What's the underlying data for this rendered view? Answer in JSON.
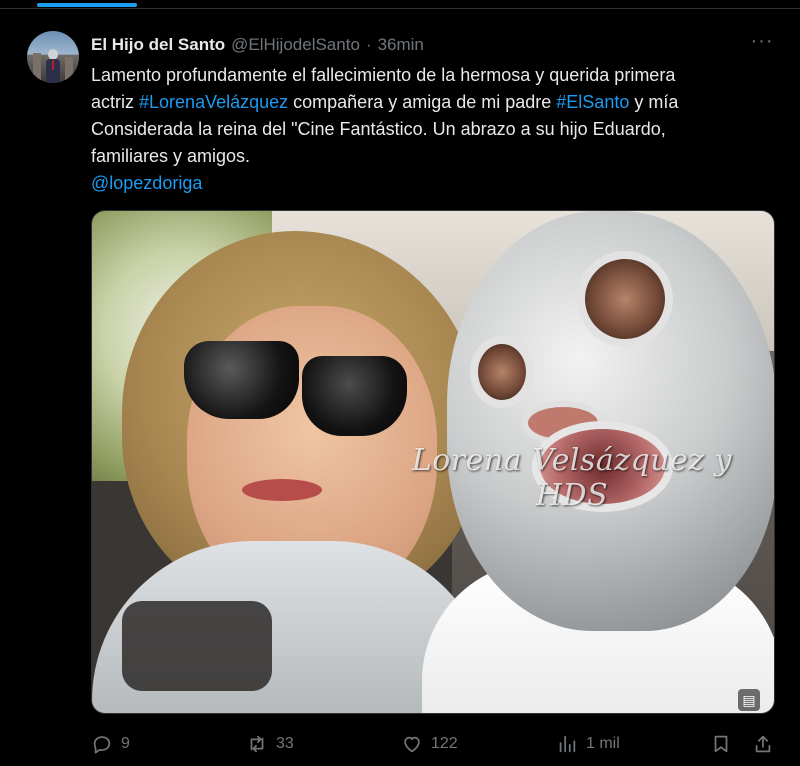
{
  "tweet": {
    "display_name": "El Hijo del Santo",
    "handle": "@ElHijodelSanto",
    "separator": "·",
    "time": "36min",
    "more_label": "···",
    "text": {
      "line1": "Lamento profundamente el fallecimiento de la hermosa y querida  primera",
      "line2_pre": "actriz ",
      "hashtag1": "#LorenaVelázquez",
      "line2_mid": " compañera y amiga de mi padre ",
      "hashtag2": "#ElSanto",
      "line2_post": " y mía",
      "line3": "Considerada la reina del \"Cine Fantástico. Un abrazo a su hijo Eduardo,",
      "line4": "familiares y amigos.",
      "mention": "@lopezdoriga"
    },
    "media": {
      "watermark": "Lorena Velsázquez y HDS",
      "alt_icon": "image-text-icon"
    },
    "actions": {
      "replies": "9",
      "reposts": "33",
      "likes": "122",
      "views": "1 mil"
    }
  },
  "colors": {
    "background": "#000000",
    "text": "#e7e9ea",
    "muted": "#71767b",
    "accent": "#1d9bf0",
    "border": "#2f3336"
  },
  "icons": [
    "reply-icon",
    "repost-icon",
    "like-icon",
    "views-icon",
    "bookmark-icon",
    "share-icon",
    "more-icon"
  ]
}
